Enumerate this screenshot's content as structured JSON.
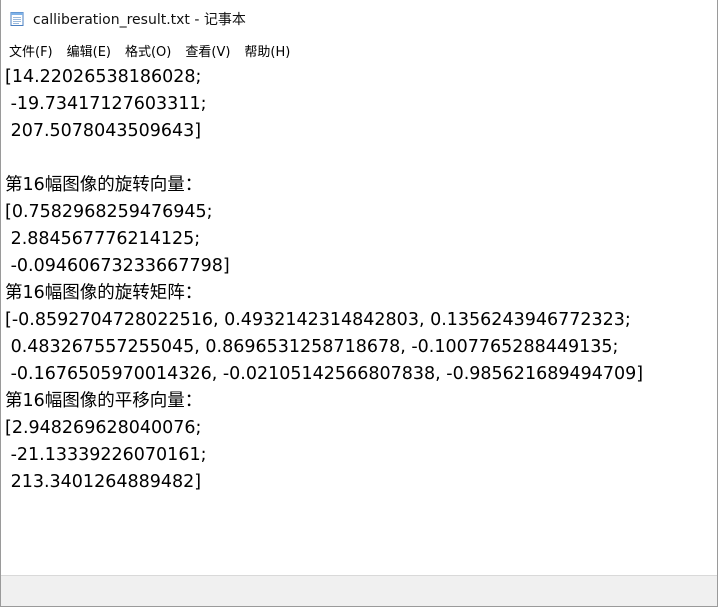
{
  "window": {
    "title": "calliberation_result.txt - 记事本",
    "icon": "notepad-icon"
  },
  "menu": [
    {
      "label": "文件(F)"
    },
    {
      "label": "编辑(E)"
    },
    {
      "label": "格式(O)"
    },
    {
      "label": "查看(V)"
    },
    {
      "label": "帮助(H)"
    }
  ],
  "editor": {
    "content": "[14.22026538186028;\n -19.73417127603311;\n 207.5078043509643]\n\n第16幅图像的旋转向量：\n[0.7582968259476945;\n 2.884567776214125;\n -0.09460673233667798]\n第16幅图像的旋转矩阵：\n[-0.8592704728022516, 0.4932142314842803, 0.1356243946772323;\n 0.483267557255045, 0.8696531258718678, -0.1007765288449135;\n -0.1676505970014326, -0.02105142566807838, -0.985621689494709]\n第16幅图像的平移向量：\n[2.948269628040076;\n -21.13339226070161;\n 213.3401264889482]"
  }
}
